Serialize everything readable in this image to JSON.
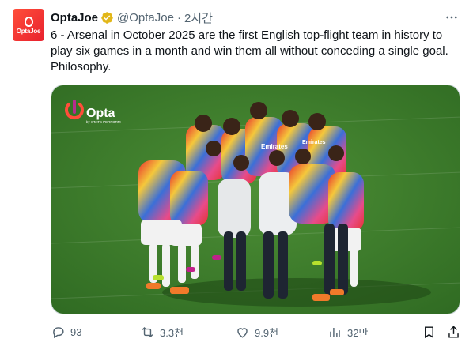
{
  "tweet": {
    "author": {
      "display_name": "OptaJoe",
      "handle": "@OptaJoe",
      "avatar_text": "OptaJoe",
      "verified_color": "#e2b719"
    },
    "separator": "·",
    "time": "2시간",
    "text": "6 - Arsenal in October 2025 are the first English top-flight team in history to play six games in a month and win them all without conceding a single goal. Philosophy.",
    "media": {
      "watermark_brand": "Opta",
      "watermark_sub": "by STATS PERFORM",
      "shirt_text": "Emirates"
    },
    "actions": {
      "replies": "93",
      "reposts": "3.3천",
      "likes": "9.9천",
      "views": "32만"
    }
  },
  "colors": {
    "text": "#0f1419",
    "secondary": "#536471",
    "pitch": "#3f7f2e",
    "brand": "#ff4e3a"
  }
}
